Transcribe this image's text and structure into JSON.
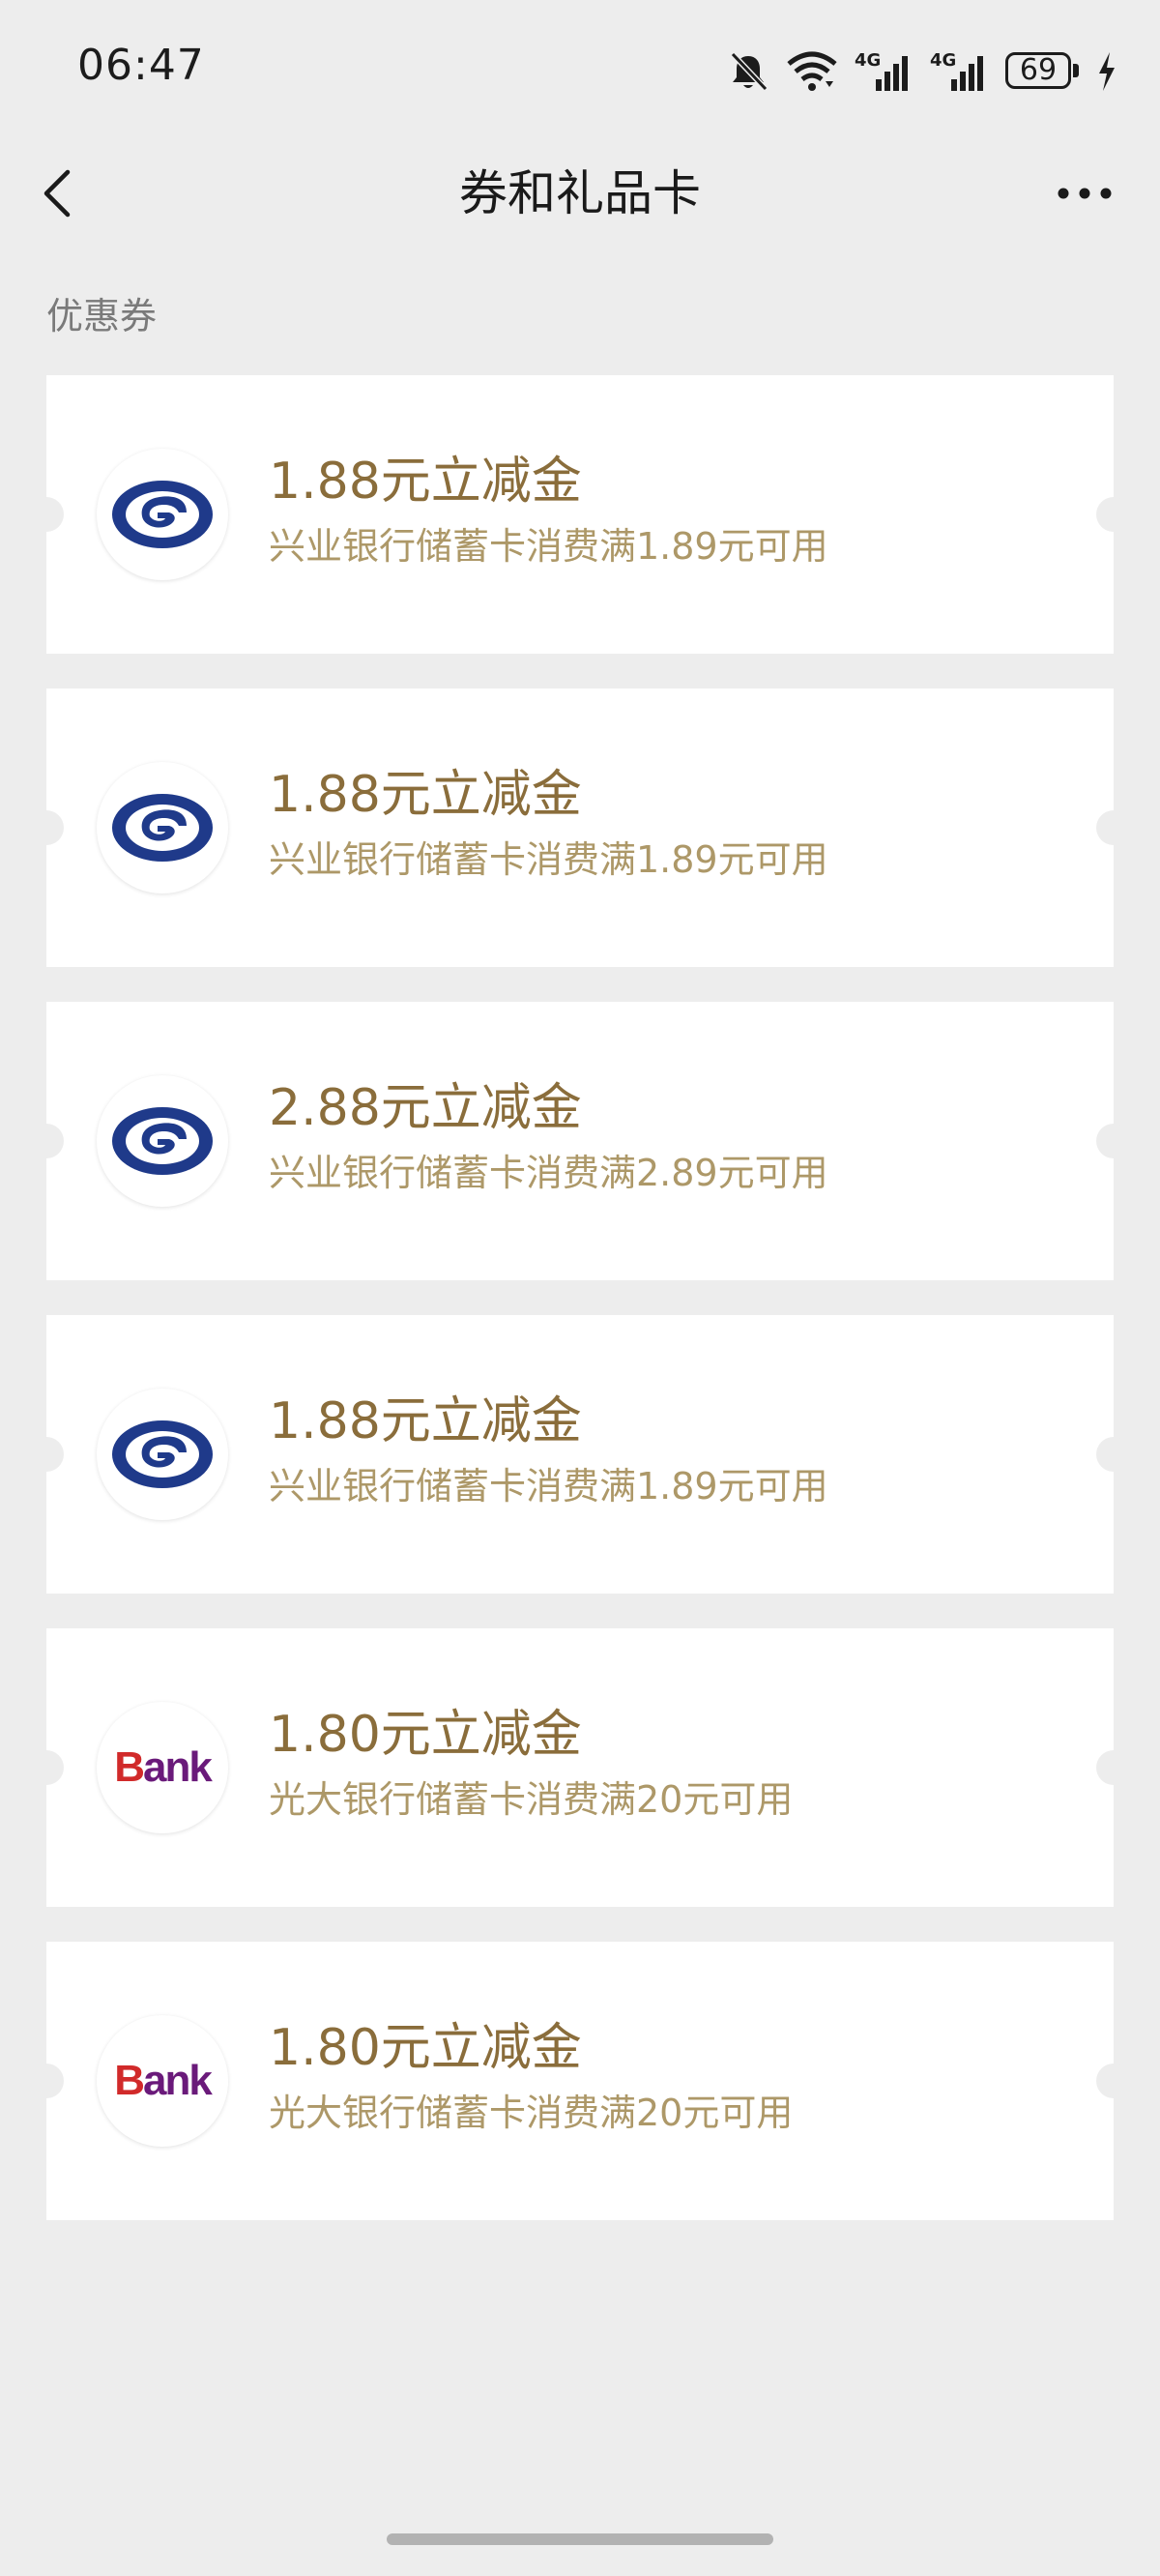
{
  "status_bar": {
    "time": "06:47",
    "battery": "69",
    "network_1": "4G",
    "network_2": "4G"
  },
  "nav": {
    "title": "券和礼品卡"
  },
  "section": {
    "label": "优惠券"
  },
  "colors": {
    "background": "#ededed",
    "card": "#ffffff",
    "gold_title": "#8a6d3b",
    "gold_desc": "#ad9868",
    "cib_blue": "#1f3a8a",
    "ceb_red": "#d12a2a",
    "ceb_purple": "#6a1a7a"
  },
  "coupons": [
    {
      "title": "1.88元立减金",
      "desc": "兴业银行储蓄卡消费满1.89元可用",
      "logo": "cib-logo-icon"
    },
    {
      "title": "1.88元立减金",
      "desc": "兴业银行储蓄卡消费满1.89元可用",
      "logo": "cib-logo-icon"
    },
    {
      "title": "2.88元立减金",
      "desc": "兴业银行储蓄卡消费满2.89元可用",
      "logo": "cib-logo-icon"
    },
    {
      "title": "1.88元立减金",
      "desc": "兴业银行储蓄卡消费满1.89元可用",
      "logo": "cib-logo-icon"
    },
    {
      "title": "1.80元立减金",
      "desc": "光大银行储蓄卡消费满20元可用",
      "logo": "ceb-logo-icon",
      "logo_text_cap": "B",
      "logo_text_rest": "ank"
    },
    {
      "title": "1.80元立减金",
      "desc": "光大银行储蓄卡消费满20元可用",
      "logo": "ceb-logo-icon",
      "logo_text_cap": "B",
      "logo_text_rest": "ank"
    }
  ]
}
